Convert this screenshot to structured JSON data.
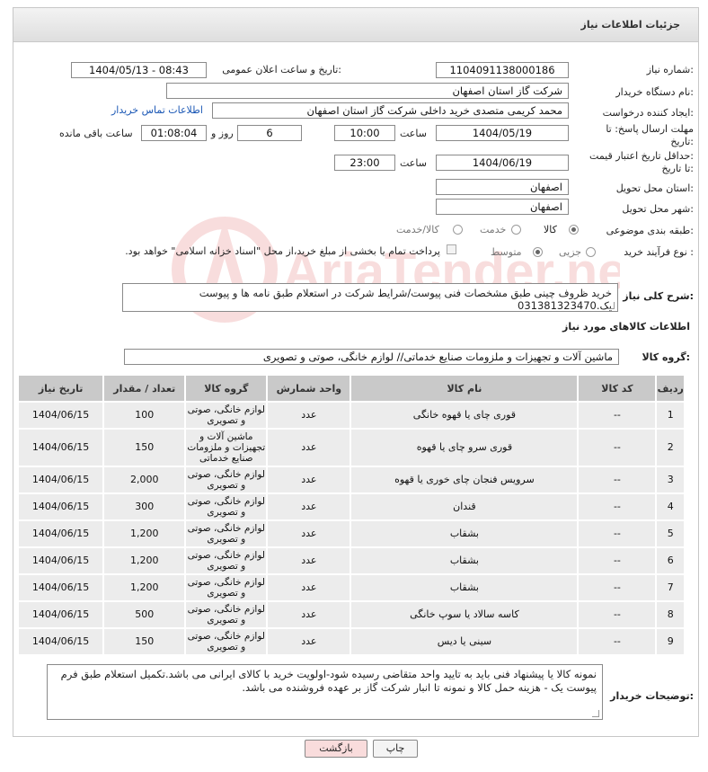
{
  "page": {
    "title": "جزئیات اطلاعات نیاز"
  },
  "fields": {
    "need_number_label": "شماره نیاز:",
    "need_number": "1104091138000186",
    "announce_label": "تاریخ و ساعت اعلان عمومی:",
    "announce_value": "1404/05/13 - 08:43",
    "buyer_org_label": "نام دستگاه خریدار:",
    "buyer_org": "شرکت گاز استان اصفهان",
    "creator_label": "ایجاد کننده درخواست:",
    "creator": "محمد کریمی متصدی خرید داخلی شرکت گاز استان اصفهان",
    "contact_link": "اطلاعات تماس خریدار",
    "deadline_label_1": "مهلت ارسال پاسخ: تا",
    "deadline_label_2": "تاریخ:",
    "deadline_date": "1404/05/19",
    "time_label": "ساعت",
    "deadline_time": "10:00",
    "days_value": "6",
    "days_label": "روز و",
    "remaining_time": "01:08:04",
    "remaining_label": "ساعت باقی مانده",
    "validity_label_1": "حداقل تاریخ اعتبار قیمت:",
    "validity_label_2": "تا تاریخ:",
    "validity_date": "1404/06/19",
    "validity_time": "23:00",
    "province_label": "استان محل تحویل:",
    "province": "اصفهان",
    "city_label": "شهر محل تحویل:",
    "city": "اصفهان",
    "category_label": "طبقه بندی موضوعی:",
    "cat_goods": "کالا",
    "cat_service": "خدمت",
    "cat_goods_service": "کالا/خدمت",
    "process_label": "نوع فرآیند خرید :",
    "proc_minor": "جزیی",
    "proc_medium": "متوسط",
    "payment_note": "پرداخت تمام یا بخشی از مبلغ خرید،از محل \"اسناد خزانه اسلامی\" خواهد بود.",
    "summary_label": "شرح کلی نیاز:",
    "summary": "خرید ظروف چینی طبق مشخصات فنی پیوست/شرایط شرکت در استعلام طبق نامه ها و پیوست یک.031381323470",
    "goods_info_label": "اطلاعات کالاهای مورد نیاز",
    "goods_group_label": "گروه کالا:",
    "goods_group": "ماشین آلات و تجهیزات و ملزومات صنایع خدماتی// لوازم خانگی، صوتی و تصویری",
    "buyer_notes_label": "توضیحات خریدار:",
    "buyer_notes": "نمونه کالا یا پیشنهاد فنی باید به تایید واحد متقاضی رسیده شود-اولویت خرید با کالای ایرانی می باشد.تکمیل استعلام طبق فرم پیوست یک - هزینه حمل کالا و نمونه تا انبار شرکت گاز بر عهده فروشنده می باشد."
  },
  "table": {
    "headers": [
      "ردیف",
      "کد کالا",
      "نام کالا",
      "واحد شمارش",
      "گروه کالا",
      "تعداد / مقدار",
      "تاریخ نیاز"
    ],
    "rows": [
      {
        "n": "1",
        "code": "--",
        "name": "قوری چای یا قهوه خانگی",
        "unit": "عدد",
        "group": "لوازم خانگی، صوتی و تصویری",
        "qty": "100",
        "date": "1404/06/15"
      },
      {
        "n": "2",
        "code": "--",
        "name": "قوری سرو چای یا قهوه",
        "unit": "عدد",
        "group": "ماشین آلات و تجهیزات و ملزومات صنایع خدماتی",
        "qty": "150",
        "date": "1404/06/15"
      },
      {
        "n": "3",
        "code": "--",
        "name": "سرویس فنجان چای خوری یا قهوه",
        "unit": "عدد",
        "group": "لوازم خانگی، صوتی و تصویری",
        "qty": "2,000",
        "date": "1404/06/15"
      },
      {
        "n": "4",
        "code": "--",
        "name": "قندان",
        "unit": "عدد",
        "group": "لوازم خانگی، صوتی و تصویری",
        "qty": "300",
        "date": "1404/06/15"
      },
      {
        "n": "5",
        "code": "--",
        "name": "بشقاب",
        "unit": "عدد",
        "group": "لوازم خانگی، صوتی و تصویری",
        "qty": "1,200",
        "date": "1404/06/15"
      },
      {
        "n": "6",
        "code": "--",
        "name": "بشقاب",
        "unit": "عدد",
        "group": "لوازم خانگی، صوتی و تصویری",
        "qty": "1,200",
        "date": "1404/06/15"
      },
      {
        "n": "7",
        "code": "--",
        "name": "بشقاب",
        "unit": "عدد",
        "group": "لوازم خانگی، صوتی و تصویری",
        "qty": "1,200",
        "date": "1404/06/15"
      },
      {
        "n": "8",
        "code": "--",
        "name": "کاسه سالاد یا سوپ خانگی",
        "unit": "عدد",
        "group": "لوازم خانگی، صوتی و تصویری",
        "qty": "500",
        "date": "1404/06/15"
      },
      {
        "n": "9",
        "code": "--",
        "name": "سینی یا دیس",
        "unit": "عدد",
        "group": "لوازم خانگی، صوتی و تصویری",
        "qty": "150",
        "date": "1404/06/15"
      }
    ]
  },
  "buttons": {
    "print": "چاپ",
    "back": "بازگشت"
  },
  "watermark": "AriaTender.net",
  "colors": {
    "link": "#1a57b5",
    "back_button": "#f9dcdc",
    "header": "#e6e6e6"
  }
}
